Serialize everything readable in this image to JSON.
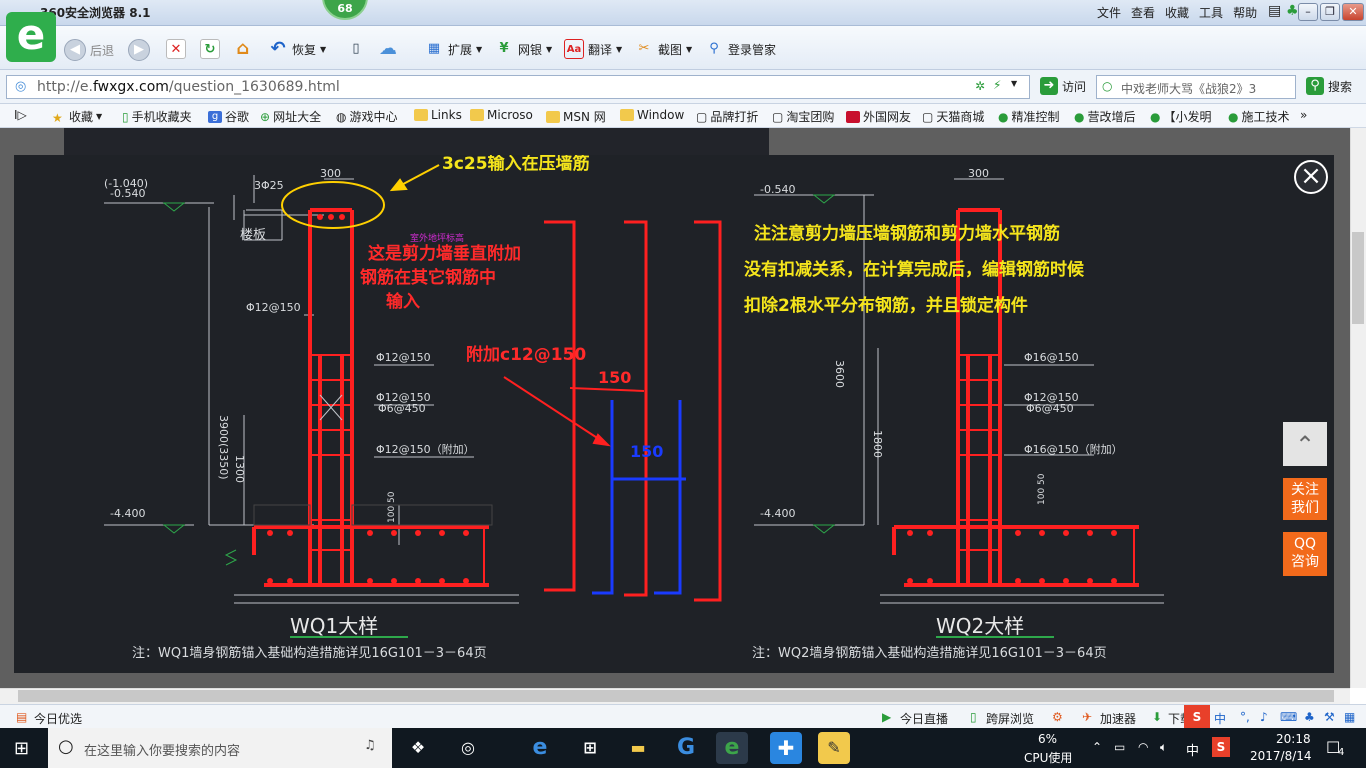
{
  "window": {
    "title": "360安全浏览器 8.1",
    "badge": "68",
    "menu": [
      "文件",
      "查看",
      "收藏",
      "工具",
      "帮助"
    ],
    "buttons": {
      "minimize": "–",
      "maximize": "❐",
      "close": "✕"
    }
  },
  "toolbar": {
    "back": "后退",
    "restore": "恢复",
    "items": [
      "扩展",
      "网银",
      "翻译",
      "截图",
      "登录管家"
    ]
  },
  "address": {
    "url_prefix": "http://e.",
    "url_domain": "fwxgx.com",
    "url_path": "/question_1630689.html",
    "visit": "访问",
    "search_text": "中戏老师大骂《战狼2》3",
    "search_button": "搜索"
  },
  "favorites": [
    "收藏",
    "手机收藏夹",
    "谷歌",
    "网址大全",
    "游戏中心",
    "Links",
    "Microso",
    "MSN 网",
    "Window",
    "品牌打折",
    "淘宝团购",
    "外国网友",
    "天猫商城",
    "精准控制",
    "营改增后",
    "【小发明",
    "施工技术"
  ],
  "drawing": {
    "left": {
      "top_elev1": "(-1.040)",
      "top_elev2": "-0.540",
      "rebar_top": "3Φ25",
      "width_300": "300",
      "slab": "楼板",
      "outdoor": "室外地坪标高",
      "r1": "Φ12@150",
      "r2": "Φ12@150",
      "r3": "Φ12@150",
      "r4": "Φ6@450",
      "r5": "Φ12@150（附加）",
      "height": "3900(3350)",
      "h1300": "1300",
      "bottom_elev": "-4.400",
      "dim_b": "100 50",
      "title": "WQ1大样",
      "note": "注：WQ1墙身钢筋锚入基础构造措施详见16G101－3－64页"
    },
    "right": {
      "top_elev": "-0.540",
      "width_300": "300",
      "r1": "Φ16@150",
      "r2": "Φ12@150",
      "r3": "Φ6@450",
      "r4": "Φ16@150（附加）",
      "height": "3600",
      "h1800": "1800",
      "bottom_elev": "-4.400",
      "dim_b": "100 50",
      "title": "WQ2大样",
      "note": "注：WQ2墙身钢筋锚入基础构造措施详见16G101－3－64页"
    },
    "annotations": {
      "a1": "3c25输入在压墙筋",
      "a2_line1": "这是剪力墙垂直附加",
      "a2_line2": "钢筋在其它钢筋中",
      "a2_line3": "输入",
      "a3": "附加c12@150",
      "dim150a": "150",
      "dim150b": "150",
      "note_line1": "注注意剪力墙压墙钢筋和剪力墙水平钢筋",
      "note_line2": "没有扣减关系，在计算完成后，编辑钢筋时候",
      "note_line3": "扣除2根水平分布钢筋，并且锁定构件"
    }
  },
  "side": {
    "follow": [
      "关注",
      "我们"
    ],
    "qq": [
      "QQ",
      "咨询"
    ]
  },
  "status": {
    "left": "今日优选",
    "items": [
      "今日直播",
      "跨屏浏览",
      "加速器",
      "下载"
    ]
  },
  "taskbar": {
    "search_placeholder": "在这里输入你要搜索的内容",
    "cpu_pct": "6%",
    "cpu_label": "CPU使用",
    "ime": "中",
    "time": "20:18",
    "date": "2017/8/14",
    "notif": "4"
  },
  "colors": {
    "annot_yellow": "#f5e51c",
    "annot_red": "#ff2a2a",
    "cad_blue": "#1a3bff",
    "accent_orange": "#f26a1b"
  }
}
